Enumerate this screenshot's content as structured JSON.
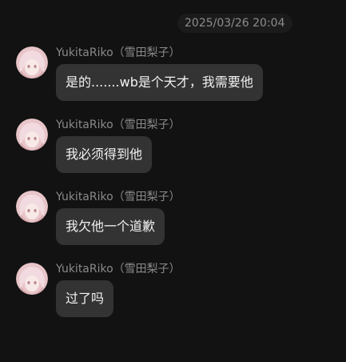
{
  "chat": {
    "timestamp": "2025/03/26 20:04",
    "messages": [
      {
        "sender": "YukitaRiko（雪田梨子）",
        "text": "是的.......wb是个天才，我需要他"
      },
      {
        "sender": "YukitaRiko（雪田梨子）",
        "text": "我必须得到他"
      },
      {
        "sender": "YukitaRiko（雪田梨子）",
        "text": "我欠他一个道歉"
      },
      {
        "sender": "YukitaRiko（雪田梨子）",
        "text": "过了吗"
      }
    ]
  },
  "colors": {
    "background": "#121212",
    "bubble": "#333333",
    "sender_text": "#8a8a8a",
    "message_text": "#f2f2f2"
  },
  "icons": {
    "avatar": "anime-girl-avatar-icon"
  }
}
